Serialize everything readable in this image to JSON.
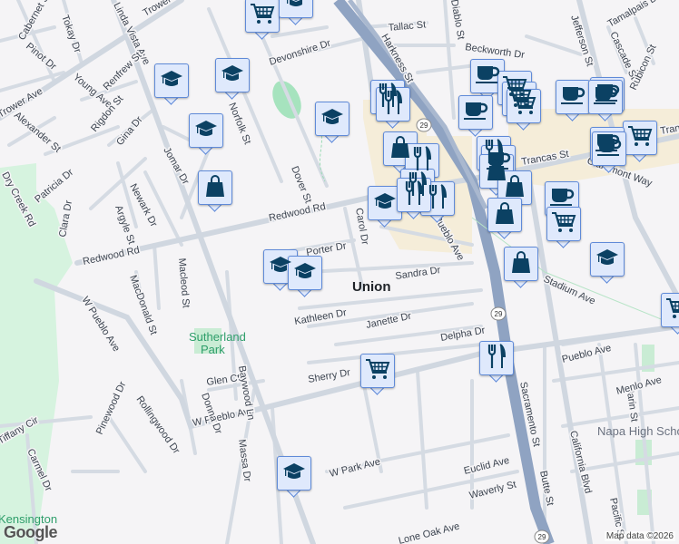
{
  "map": {
    "streets": [
      "Trower Ave",
      "Trower Ave",
      "Linda Vista Ave",
      "Cabernet St",
      "Tokay Dr",
      "Pinot Dr",
      "Young Ave",
      "Renfrew St",
      "Alexander St",
      "Rigdon St",
      "Gina Dr",
      "Jomar Dr",
      "Patricia Dr",
      "Dry Creek Rd",
      "Newark Dr",
      "Argyle St",
      "Clara Dr",
      "Redwood Rd",
      "Redwood Rd",
      "Norfolk St",
      "Dover St",
      "Devonshire Dr",
      "Tallac St",
      "Harkness St",
      "Diablo St",
      "Beckworth Dr",
      "Jefferson St",
      "Tamalpais Dr",
      "Cascade St",
      "Rubicon St",
      "Claremont Way",
      "Carol Dr",
      "Porter Dr",
      "Sandra Dr",
      "Stadium Ave",
      "Kathleen Dr",
      "Janette Dr",
      "Delpha Dr",
      "Pueblo Ave",
      "W Pueblo Ave",
      "W Pueblo Ave",
      "MacDonald St",
      "Macleod St",
      "Glen Ct",
      "Baywood Ln",
      "Sherry Dr",
      "Donna Dr",
      "Massa Dr",
      "Pinewood Dr",
      "Rollingwood Dr",
      "Tiffany Cir",
      "Carmel Dr",
      "W Park Ave",
      "Euclid Ave",
      "Waverly St",
      "Sacramento St",
      "California Blvd",
      "Butte St",
      "Marin St",
      "Menlo Ave",
      "Pacific St",
      "Lone Oak Ave",
      "Pueblo Ave",
      "Trancas St",
      "Trancas St"
    ],
    "place_union": "Union",
    "park_sutherland_1": "Sutherland",
    "park_sutherland_2": "Park",
    "poi_napa_high": "Napa High School",
    "poi_kensington": "Kensington",
    "hwy_shield": "29",
    "credit": "Map data ©2026",
    "logo": "Google"
  },
  "marker_types": [
    "school",
    "shopping",
    "grocery",
    "cafe",
    "restaurant"
  ],
  "colors": {
    "marker_fill": "#dfe9fc",
    "marker_border": "#5f8ad8",
    "icon": "#0b4163",
    "highway": "#8fa3c2",
    "road": "#d5dbe3",
    "park": "#c9ecd4",
    "commercial": "#f5edd9"
  }
}
